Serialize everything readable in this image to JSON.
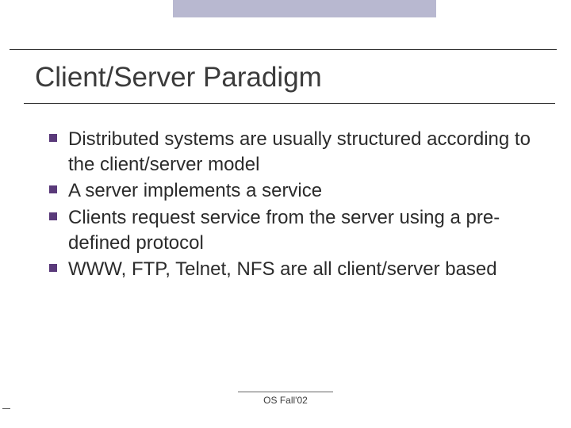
{
  "title": "Client/Server Paradigm",
  "bullets": [
    "Distributed systems are usually structured according to the client/server model",
    "A server implements a service",
    "Clients request service from the server using a pre-defined protocol",
    "WWW, FTP, Telnet, NFS are all client/server based"
  ],
  "footer": "OS Fall'02"
}
